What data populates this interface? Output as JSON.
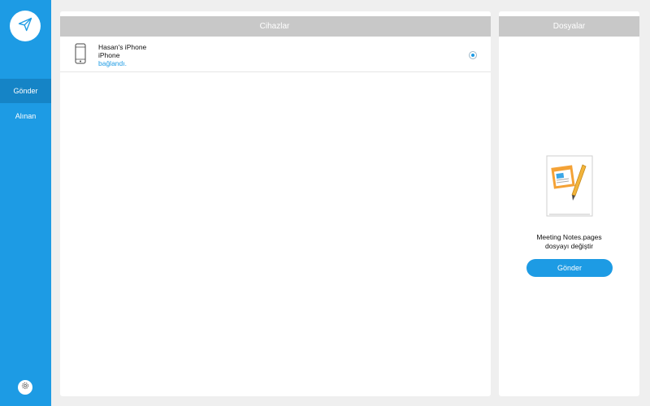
{
  "sidebar": {
    "nav": [
      {
        "label": "Gönder",
        "active": true
      },
      {
        "label": "Alınan",
        "active": false
      }
    ],
    "logo_icon": "paper-plane-icon",
    "settings_icon": "gear-icon"
  },
  "devices_panel": {
    "title": "Cihazlar",
    "devices": [
      {
        "name": "Hasan's iPhone",
        "model": "iPhone",
        "status": "bağlandı.",
        "selected": true,
        "icon": "iphone-icon"
      }
    ]
  },
  "files_panel": {
    "title": "Dosyalar",
    "file_name": "Meeting Notes.pages",
    "change_label": "dosyayı değiştir",
    "send_label": "Gönder",
    "file_icon": "pages-document-icon"
  },
  "colors": {
    "accent": "#1d9be4",
    "sidebar_active": "#1584c6",
    "header_gray": "#c8c8c8",
    "background": "#efefef"
  }
}
